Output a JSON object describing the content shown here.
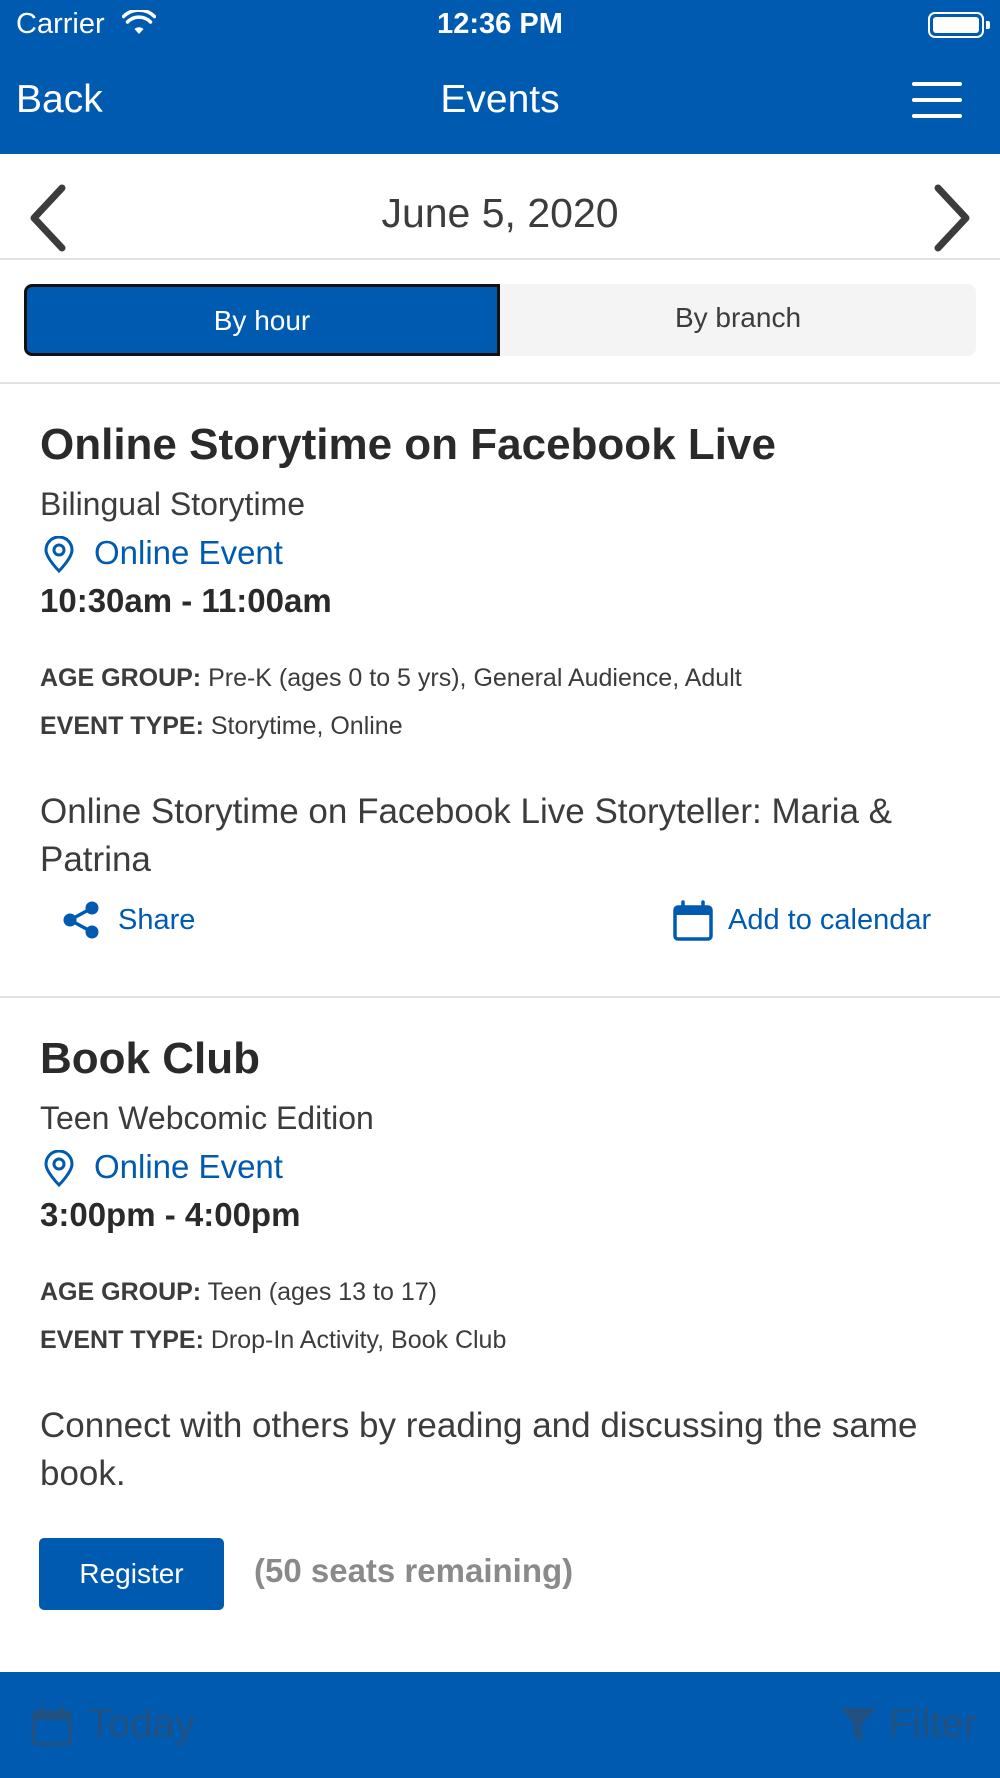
{
  "status_bar": {
    "carrier": "Carrier",
    "time": "12:36 PM"
  },
  "header": {
    "back_label": "Back",
    "title": "Events"
  },
  "date_nav": {
    "date": "June 5, 2020"
  },
  "segments": [
    {
      "label": "By hour",
      "selected": true
    },
    {
      "label": "By branch",
      "selected": false
    }
  ],
  "events": [
    {
      "title": "Online Storytime on Facebook Live",
      "subtitle": "Bilingual Storytime",
      "location": "Online Event",
      "time": "10:30am - 11:00am",
      "age_group_label": "AGE GROUP:",
      "age_group": "Pre-K (ages 0 to 5 yrs), General Audience, Adult",
      "event_type_label": "EVENT TYPE:",
      "event_type": "Storytime, Online",
      "description": "Online Storytime on Facebook Live Storyteller: Maria & Patrina",
      "share_label": "Share",
      "calendar_label": "Add to calendar"
    },
    {
      "title": "Book Club",
      "subtitle": "Teen Webcomic Edition",
      "location": "Online Event",
      "time": "3:00pm - 4:00pm",
      "age_group_label": "AGE GROUP:",
      "age_group": "Teen (ages 13 to 17)",
      "event_type_label": "EVENT TYPE:",
      "event_type": "Drop-In Activity, Book Club",
      "description": "Connect with others by reading and discussing the same book.",
      "register_label": "Register",
      "seats_label": "(50 seats remaining)"
    }
  ],
  "bottom_bar": {
    "today_label": "Today",
    "filter_label": "Filter"
  },
  "colors": {
    "brand": "#005bb0",
    "background": "#ffffff",
    "muted": "#8a8a8a"
  }
}
